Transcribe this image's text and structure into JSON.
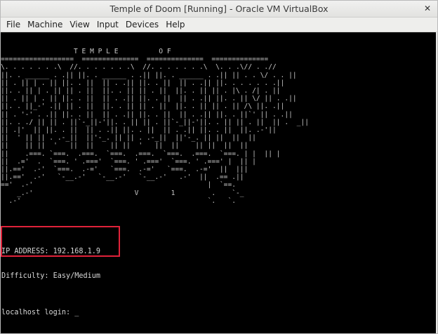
{
  "window": {
    "title": "Temple of Doom [Running] - Oracle VM VirtualBox",
    "close_glyph": "✕"
  },
  "menubar": {
    "items": [
      "File",
      "Machine",
      "View",
      "Input",
      "Devices",
      "Help"
    ]
  },
  "terminal": {
    "banner": "                  T E M P L E          O F\n==================  ==============  ==============  ==============\n\\. . . . . . .\\  //. . . . . . .\\  //. . . . . . .\\  \\. . .\\// . .//\n||. . ______ . .|| ||. . ______ . .|| ||. . ______ . .|| || . . \\/ . . ||\n|| . || | . || ||. . ||  || . .|| ||. . ||  || . .|| ||. . . . . . .||\n||. . || | . || || . ||  ||. . || || . ||  ||. . || || . |\\ . /| . ||\n|| . || | . || ||. . ||  || . .|| ||. . ||  || . .|| ||. . || \\/ || . .||\n||. . ||_-' .|| || . ||  ||. . || || . ||  ||. . || || . || /\\ ||. .||\n|| . '-' . .|| ||. . ||  || . .|| ||. . ||  || . .|| ||. . ||`' || . .||\n||. . ./ || || . ||`-_||-'||. . || || . ||`-_||-'||. . || || . ||  || .  _||\n|| .|'  || ||. . ||  || . .|| ||. . ||  || . .|| ||. . ||  ||. .-'||\n||  ' || || . .-_||  ||'-_. || || . .-_||  ||'-_. || ||  ||  ||\n||    || ||  '   ||  ||    || ||  '   ||  ||    || ||  ||  ||\n||    .===. `===.  .===.  `===.  .===.  `===.  .===.  `===. | |  || |\n||  .='  .  `===. ' .==='  `===. ' .==='  `===. ' .===' |  || |\n||.=='  .-'  `===.  .-='   `===.  .-='   `===.  .-='  ||  |||\n||.=='  .-'   `-__.-'   `-__.-'   `-__.-'   .-'  ||  .== .||\n=='  .-'                                           |  `==.\n    _.-'                         V        1         .    `-_\n  .-'                                              `.   `.\n",
    "ip_address": "IP ADDRESS: 192.168.1.9",
    "difficulty": "Difficulty: Easy/Medium",
    "login_prompt": "localhost login: ",
    "cursor": "_"
  },
  "colors": {
    "terminal_bg": "#000000",
    "terminal_fg": "#d7d7d7",
    "highlight_box": "#e0223a"
  }
}
